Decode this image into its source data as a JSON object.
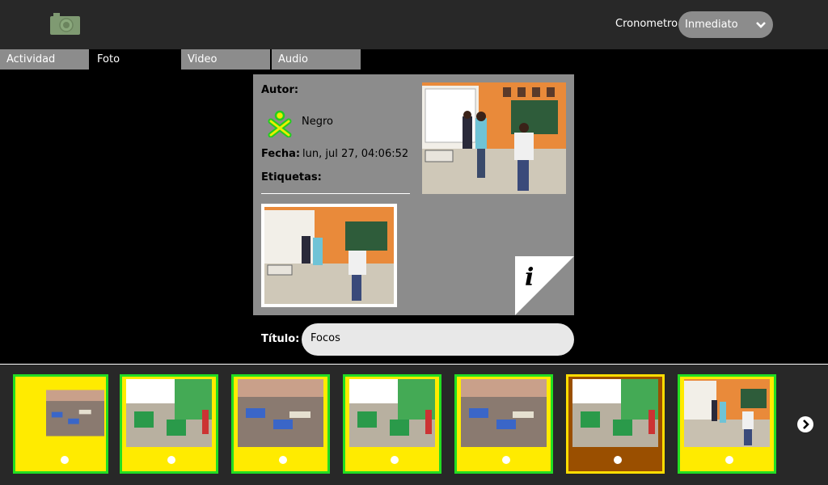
{
  "toolbar": {
    "camera_icon": "camera-icon",
    "chrono_label": "Cronometro",
    "chrono_value": "Inmediato"
  },
  "tabs": [
    {
      "label": "Actividad"
    },
    {
      "label": "Foto"
    },
    {
      "label": "Video"
    },
    {
      "label": "Audio"
    }
  ],
  "details": {
    "author_label": "Autor:",
    "author_name": "Negro",
    "date_label": "Fecha:",
    "date_value": "lun, jul 27, 04:06:52",
    "tags_label": "Etiquetas:",
    "title_label": "Título:",
    "title_value": "Focos"
  },
  "colors": {
    "thumb_fill": "#ffeb00",
    "thumb_border": "#22dd22",
    "selected_fill": "#9a4f00",
    "xo_stroke": "#22cc22",
    "xo_fill": "#e8f000"
  },
  "thumbnails": [
    {
      "scene": "classroom-empty"
    },
    {
      "scene": "classroom-students"
    },
    {
      "scene": "classroom-empty"
    },
    {
      "scene": "classroom-students"
    },
    {
      "scene": "classroom-empty"
    },
    {
      "scene": "classroom-students",
      "selected": true
    },
    {
      "scene": "classroom-girls"
    }
  ]
}
